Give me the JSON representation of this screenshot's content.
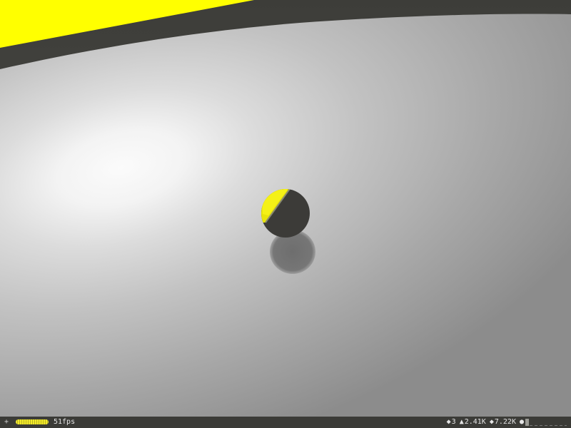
{
  "colors": {
    "accent_yellow": "#ffff00",
    "ball_dark": "#3c3b38",
    "floor_light": "#f4f4f4",
    "floor_dark": "#8a8a8a",
    "wall": "#3f3f3b",
    "statusbar_bg": "#3b3b37",
    "statusbar_text": "#e6e6e6"
  },
  "scene": {
    "objects": [
      "floor",
      "back-wall",
      "yellow-panel",
      "ball",
      "ball-shadow",
      "spotlight"
    ]
  },
  "statusbar": {
    "menu_icon": "plus-icon",
    "menu_glyph": "+",
    "load_progress": 1.0,
    "fps_text": "51fps",
    "stats": [
      {
        "icon": "diamond-icon",
        "glyph": "◆",
        "value": "3"
      },
      {
        "icon": "triangle-icon",
        "glyph": "▲",
        "value": "2.41K"
      },
      {
        "icon": "vertex-icon",
        "glyph": "◆",
        "value": "7.22K"
      }
    ],
    "dot_glyph": "●"
  }
}
